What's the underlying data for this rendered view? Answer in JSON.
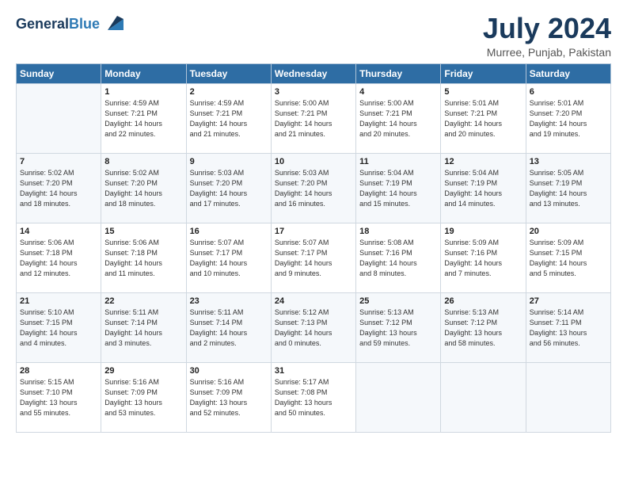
{
  "header": {
    "logo_line1": "General",
    "logo_line2": "Blue",
    "title": "July 2024",
    "location": "Murree, Punjab, Pakistan"
  },
  "days_of_week": [
    "Sunday",
    "Monday",
    "Tuesday",
    "Wednesday",
    "Thursday",
    "Friday",
    "Saturday"
  ],
  "weeks": [
    [
      {
        "num": "",
        "info": ""
      },
      {
        "num": "1",
        "info": "Sunrise: 4:59 AM\nSunset: 7:21 PM\nDaylight: 14 hours\nand 22 minutes."
      },
      {
        "num": "2",
        "info": "Sunrise: 4:59 AM\nSunset: 7:21 PM\nDaylight: 14 hours\nand 21 minutes."
      },
      {
        "num": "3",
        "info": "Sunrise: 5:00 AM\nSunset: 7:21 PM\nDaylight: 14 hours\nand 21 minutes."
      },
      {
        "num": "4",
        "info": "Sunrise: 5:00 AM\nSunset: 7:21 PM\nDaylight: 14 hours\nand 20 minutes."
      },
      {
        "num": "5",
        "info": "Sunrise: 5:01 AM\nSunset: 7:21 PM\nDaylight: 14 hours\nand 20 minutes."
      },
      {
        "num": "6",
        "info": "Sunrise: 5:01 AM\nSunset: 7:20 PM\nDaylight: 14 hours\nand 19 minutes."
      }
    ],
    [
      {
        "num": "7",
        "info": "Sunrise: 5:02 AM\nSunset: 7:20 PM\nDaylight: 14 hours\nand 18 minutes."
      },
      {
        "num": "8",
        "info": "Sunrise: 5:02 AM\nSunset: 7:20 PM\nDaylight: 14 hours\nand 18 minutes."
      },
      {
        "num": "9",
        "info": "Sunrise: 5:03 AM\nSunset: 7:20 PM\nDaylight: 14 hours\nand 17 minutes."
      },
      {
        "num": "10",
        "info": "Sunrise: 5:03 AM\nSunset: 7:20 PM\nDaylight: 14 hours\nand 16 minutes."
      },
      {
        "num": "11",
        "info": "Sunrise: 5:04 AM\nSunset: 7:19 PM\nDaylight: 14 hours\nand 15 minutes."
      },
      {
        "num": "12",
        "info": "Sunrise: 5:04 AM\nSunset: 7:19 PM\nDaylight: 14 hours\nand 14 minutes."
      },
      {
        "num": "13",
        "info": "Sunrise: 5:05 AM\nSunset: 7:19 PM\nDaylight: 14 hours\nand 13 minutes."
      }
    ],
    [
      {
        "num": "14",
        "info": "Sunrise: 5:06 AM\nSunset: 7:18 PM\nDaylight: 14 hours\nand 12 minutes."
      },
      {
        "num": "15",
        "info": "Sunrise: 5:06 AM\nSunset: 7:18 PM\nDaylight: 14 hours\nand 11 minutes."
      },
      {
        "num": "16",
        "info": "Sunrise: 5:07 AM\nSunset: 7:17 PM\nDaylight: 14 hours\nand 10 minutes."
      },
      {
        "num": "17",
        "info": "Sunrise: 5:07 AM\nSunset: 7:17 PM\nDaylight: 14 hours\nand 9 minutes."
      },
      {
        "num": "18",
        "info": "Sunrise: 5:08 AM\nSunset: 7:16 PM\nDaylight: 14 hours\nand 8 minutes."
      },
      {
        "num": "19",
        "info": "Sunrise: 5:09 AM\nSunset: 7:16 PM\nDaylight: 14 hours\nand 7 minutes."
      },
      {
        "num": "20",
        "info": "Sunrise: 5:09 AM\nSunset: 7:15 PM\nDaylight: 14 hours\nand 5 minutes."
      }
    ],
    [
      {
        "num": "21",
        "info": "Sunrise: 5:10 AM\nSunset: 7:15 PM\nDaylight: 14 hours\nand 4 minutes."
      },
      {
        "num": "22",
        "info": "Sunrise: 5:11 AM\nSunset: 7:14 PM\nDaylight: 14 hours\nand 3 minutes."
      },
      {
        "num": "23",
        "info": "Sunrise: 5:11 AM\nSunset: 7:14 PM\nDaylight: 14 hours\nand 2 minutes."
      },
      {
        "num": "24",
        "info": "Sunrise: 5:12 AM\nSunset: 7:13 PM\nDaylight: 14 hours\nand 0 minutes."
      },
      {
        "num": "25",
        "info": "Sunrise: 5:13 AM\nSunset: 7:12 PM\nDaylight: 13 hours\nand 59 minutes."
      },
      {
        "num": "26",
        "info": "Sunrise: 5:13 AM\nSunset: 7:12 PM\nDaylight: 13 hours\nand 58 minutes."
      },
      {
        "num": "27",
        "info": "Sunrise: 5:14 AM\nSunset: 7:11 PM\nDaylight: 13 hours\nand 56 minutes."
      }
    ],
    [
      {
        "num": "28",
        "info": "Sunrise: 5:15 AM\nSunset: 7:10 PM\nDaylight: 13 hours\nand 55 minutes."
      },
      {
        "num": "29",
        "info": "Sunrise: 5:16 AM\nSunset: 7:09 PM\nDaylight: 13 hours\nand 53 minutes."
      },
      {
        "num": "30",
        "info": "Sunrise: 5:16 AM\nSunset: 7:09 PM\nDaylight: 13 hours\nand 52 minutes."
      },
      {
        "num": "31",
        "info": "Sunrise: 5:17 AM\nSunset: 7:08 PM\nDaylight: 13 hours\nand 50 minutes."
      },
      {
        "num": "",
        "info": ""
      },
      {
        "num": "",
        "info": ""
      },
      {
        "num": "",
        "info": ""
      }
    ]
  ]
}
